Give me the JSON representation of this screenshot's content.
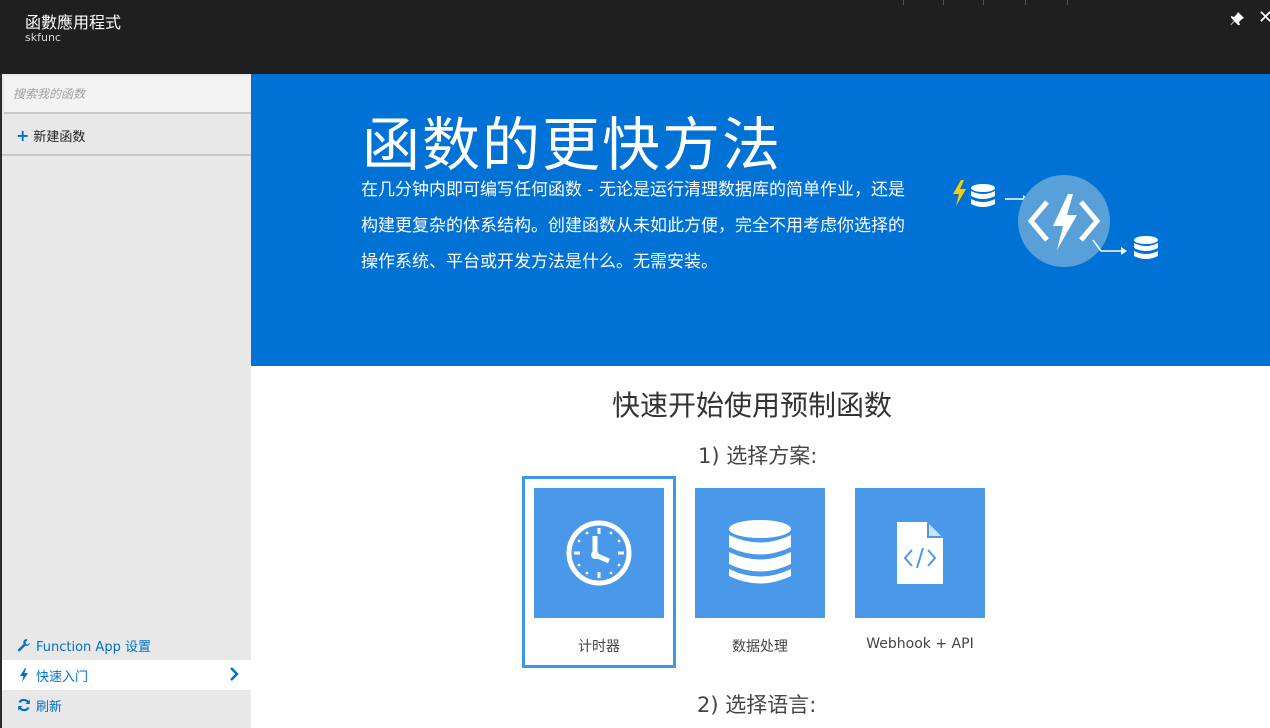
{
  "window": {
    "title": "函數應用程式",
    "subtitle": "skfunc",
    "pin_icon": "pin-icon",
    "close_icon": "close-icon",
    "close_glyph": "✕"
  },
  "sidebar": {
    "search_placeholder": "搜索我的函数",
    "new_function_label": "新建函数",
    "settings_label": "Function App 设置",
    "quickstart_label": "快速入门",
    "refresh_label": "刷新",
    "accent_color": "#0072c6"
  },
  "hero": {
    "title": "函数的更快方法",
    "description": "在几分钟内即可编写任何函数 - 无论是运行清理数据库的简单作业，还是构建更复杂的体系结构。创建函数从未如此方便，完全不用考虑你选择的操作系统、平台或开发方法是什么。无需安装。",
    "background_color": "#0072d6"
  },
  "main": {
    "quickstart_title": "快速开始使用预制函数",
    "step1_label": "1) 选择方案:",
    "step2_label": "2) 选择语言:",
    "scenarios": [
      {
        "label": "计时器",
        "icon": "clock-icon",
        "selected": true
      },
      {
        "label": "数据处理",
        "icon": "database-icon",
        "selected": false
      },
      {
        "label": "Webhook + API",
        "icon": "code-file-icon",
        "selected": false
      }
    ]
  }
}
